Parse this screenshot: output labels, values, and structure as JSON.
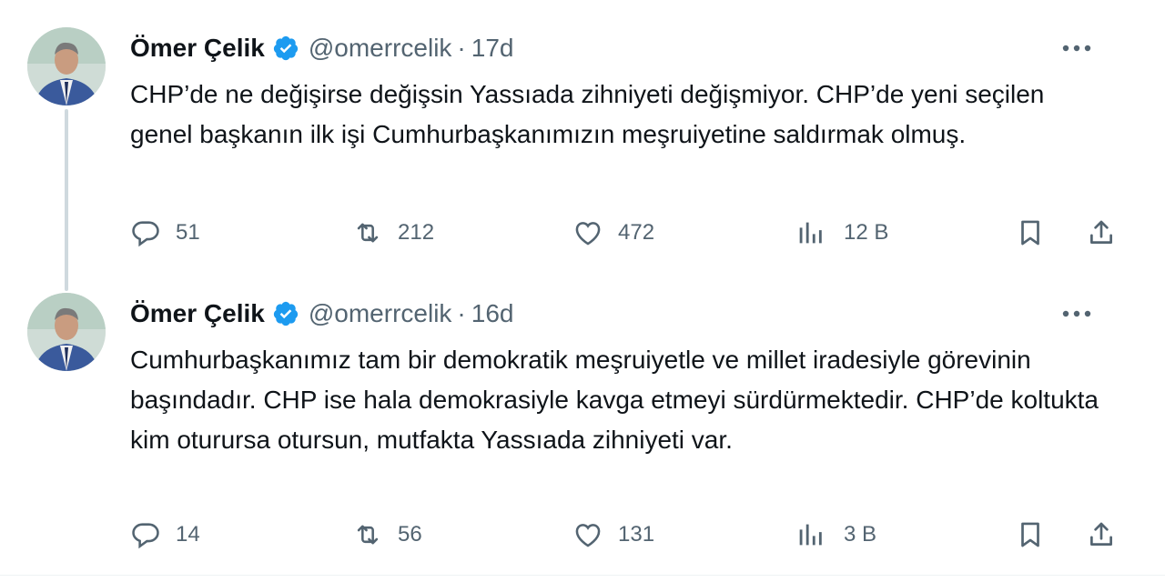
{
  "colors": {
    "accent": "#1d9bf0",
    "text": "#0f1419",
    "muted": "#536471",
    "thread": "#cfd9de"
  },
  "tweets": [
    {
      "name": "Ömer Çelik",
      "handle": "@omerrcelik",
      "separator": "·",
      "time": "17d",
      "text": "CHP’de ne değişirse değişsin Yassıada zihniyeti değişmiyor. CHP’de yeni seçilen genel başkanın ilk işi Cumhurbaşkanımızın meşruiyetine saldırmak olmuş.",
      "replies": "51",
      "retweets": "212",
      "likes": "472",
      "views": "12 B"
    },
    {
      "name": "Ömer Çelik",
      "handle": "@omerrcelik",
      "separator": "·",
      "time": "16d",
      "text": "Cumhurbaşkanımız tam bir demokratik meşruiyetle ve millet iradesiyle görevinin başındadır. CHP ise hala demokrasiyle kavga etmeyi sürdürmektedir. CHP’de koltukta kim oturursa otursun, mutfakta Yassıada zihniyeti var.",
      "replies": "14",
      "retweets": "56",
      "likes": "131",
      "views": "3 B"
    }
  ],
  "icons": {
    "verified": "verified-badge-icon",
    "more": "more-horizontal-icon",
    "reply": "reply-icon",
    "retweet": "retweet-icon",
    "like": "like-icon",
    "views": "views-icon",
    "bookmark": "bookmark-icon",
    "share": "share-icon"
  }
}
